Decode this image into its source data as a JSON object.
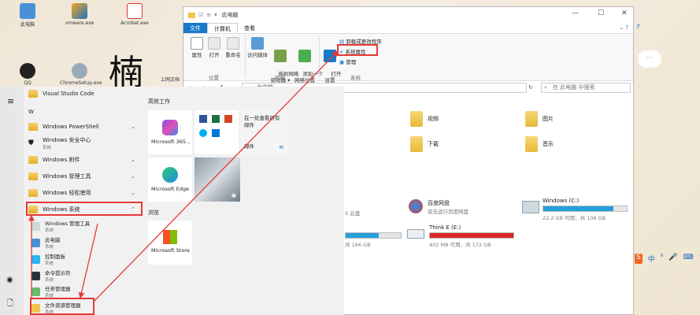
{
  "desktop": {
    "icons": [
      {
        "label": "此电脑"
      },
      {
        "label": "vmware.exe"
      },
      {
        "label": "Acrobat.exe"
      },
      {
        "label": "QQ"
      },
      {
        "label": "ChromeSetup.exe"
      },
      {
        "label": "上网文档"
      }
    ],
    "calligraphy": "楠"
  },
  "explorer": {
    "title": "此电脑",
    "tabs": [
      "文件",
      "计算机",
      "查看"
    ],
    "ribbon": {
      "buttons": [
        {
          "label": "属性",
          "icon": "check-icon"
        },
        {
          "label": "打开",
          "icon": "folder-icon"
        },
        {
          "label": "重命名",
          "icon": "rename-icon"
        },
        {
          "label": "访问媒体",
          "icon": "media-icon"
        },
        {
          "label": "映射网络\n驱动器 ▾",
          "icon": "network-drive-icon"
        },
        {
          "label": "添加一个\n网络位置",
          "icon": "network-location-icon"
        },
        {
          "label": "打开\n设置",
          "icon": "gear-icon"
        }
      ],
      "small_buttons": [
        "卸载或更改程序",
        "系统属性",
        "管理"
      ],
      "groups": [
        "位置",
        "网络",
        "系统"
      ]
    },
    "address": "此电脑",
    "search_placeholder": "在 此电脑 中搜索",
    "folders": [
      {
        "label": "视频"
      },
      {
        "label": "图片"
      },
      {
        "label": "下载"
      },
      {
        "label": "音乐"
      }
    ],
    "drives": [
      {
        "name": "Windows (C:)",
        "capacity": "22.2 GB 可用，共 136 GB",
        "used": 0.84,
        "color": "#26a0da"
      },
      {
        "name": "百度网盘",
        "capacity": "双击运行百度网盘",
        "used": null,
        "color": ""
      },
      {
        "name": "Think E (E:)",
        "capacity": "402 MB 可用，共 172 GB",
        "used": 0.998,
        "color": "#da2626"
      },
      {
        "name": "",
        "capacity": "共 166 GB",
        "used": 0.6,
        "color": "#26a0da"
      },
      {
        "name": "",
        "capacity": "S 云盘",
        "used": null,
        "color": ""
      }
    ]
  },
  "start_menu": {
    "apps": [
      {
        "label": "Visual Studio Code",
        "chev": ""
      },
      {
        "label": "W",
        "chev": ""
      },
      {
        "label": "Windows PowerShell",
        "chev": "⌄"
      },
      {
        "label": "Windows 安全中心",
        "sub": "系统",
        "chev": ""
      },
      {
        "label": "Windows 附件",
        "chev": "⌄"
      },
      {
        "label": "Windows 管理工具",
        "chev": "⌄"
      },
      {
        "label": "Windows 轻松使用",
        "chev": "⌄"
      },
      {
        "label": "Windows 系统",
        "chev": "⌃"
      }
    ],
    "sub_apps": [
      {
        "label": "Windows 管理工具",
        "sub": "系统"
      },
      {
        "label": "此电脑",
        "sub": "系统"
      },
      {
        "label": "控制面板",
        "sub": "系统"
      },
      {
        "label": "命令提示符",
        "sub": "系统"
      },
      {
        "label": "任务管理器",
        "sub": "系统"
      },
      {
        "label": "文件资源管理器",
        "sub": "系统"
      }
    ],
    "sections": [
      "高效工作",
      "浏览"
    ],
    "tiles": {
      "m365": "Microsoft 365...",
      "mail_title": "在一处查看所有\n邮件",
      "mail": "邮件",
      "edge": "Microsoft Edge",
      "store": "Microsoft Store"
    }
  },
  "taskbar_tray": [
    "S",
    "中",
    "⁰",
    "🎤",
    "⌨",
    "👕",
    "⠿"
  ]
}
